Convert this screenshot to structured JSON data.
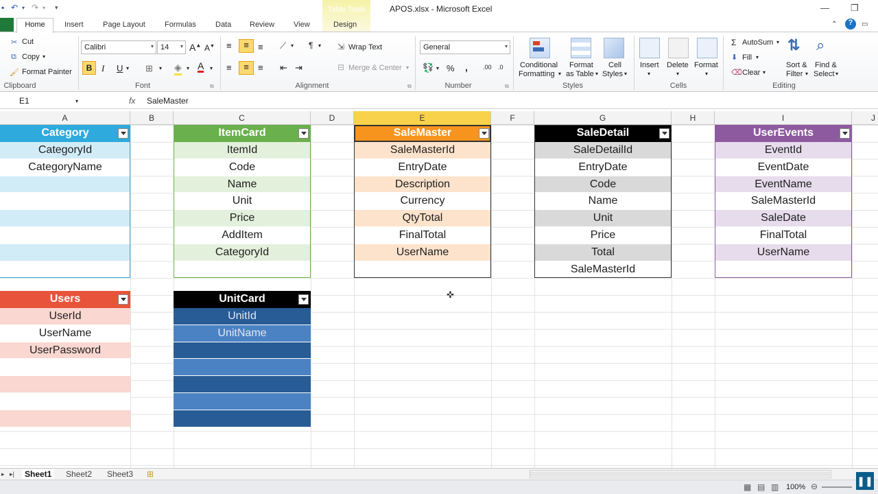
{
  "title": {
    "app_title": "APOS.xlsx  -  Microsoft Excel",
    "context_group": "Table Tools"
  },
  "tabs": [
    "Home",
    "Insert",
    "Page Layout",
    "Formulas",
    "Data",
    "Review",
    "View",
    "Design"
  ],
  "clipboard": {
    "cut": "Cut",
    "copy": "Copy",
    "format_painter": "Format Painter",
    "label": "Clipboard"
  },
  "font": {
    "name": "Calibri",
    "size": "14",
    "bold": "B",
    "italic": "I",
    "underline": "U",
    "label": "Font"
  },
  "alignment": {
    "wrap_text": "Wrap Text",
    "merge_center": "Merge & Center",
    "label": "Alignment"
  },
  "number": {
    "format": "General",
    "percent": "%",
    "comma": ",",
    "label": "Number"
  },
  "styles": {
    "conditional": "Conditional",
    "conditional2": "Formatting",
    "format_as": "Format",
    "format_as2": "as Table",
    "cell": "Cell",
    "cell2": "Styles",
    "label": "Styles"
  },
  "cells": {
    "insert": "Insert",
    "delete": "Delete",
    "format": "Format",
    "label": "Cells"
  },
  "editing": {
    "autosum": "AutoSum",
    "fill": "Fill",
    "clear": "Clear",
    "sort": "Sort &",
    "sort2": "Filter",
    "find": "Find &",
    "find2": "Select",
    "label": "Editing"
  },
  "formula_bar": {
    "name_box": "E1",
    "fx": "fx",
    "content": "SaleMaster"
  },
  "columns": [
    "A",
    "B",
    "C",
    "D",
    "E",
    "F",
    "G",
    "H",
    "I",
    "J"
  ],
  "tables": [
    {
      "name": "Category",
      "rows": [
        "CategoryId",
        "CategoryName",
        "",
        "",
        "",
        "",
        "",
        ""
      ]
    },
    {
      "name": "ItemCard",
      "rows": [
        "ItemId",
        "Code",
        "Name",
        "Unit",
        "Price",
        "AddItem",
        "CategoryId",
        ""
      ]
    },
    {
      "name": "SaleMaster",
      "rows": [
        "SaleMasterId",
        "EntryDate",
        "Description",
        "Currency",
        "QtyTotal",
        "FinalTotal",
        "UserName",
        ""
      ]
    },
    {
      "name": "SaleDetail",
      "rows": [
        "SaleDetailId",
        "EntryDate",
        "Code",
        "Name",
        "Unit",
        "Price",
        "Total",
        "SaleMasterId"
      ]
    },
    {
      "name": "UserEvents",
      "rows": [
        "EventId",
        "EventDate",
        "EventName",
        "SaleMasterId",
        "SaleDate",
        "FinalTotal",
        "UserName",
        ""
      ]
    },
    {
      "name": "Users",
      "rows": [
        "UserId",
        "UserName",
        "UserPassword",
        "",
        "",
        "",
        ""
      ]
    },
    {
      "name": "UnitCard",
      "rows": [
        "UnitId",
        "UnitName",
        "",
        "",
        "",
        "",
        ""
      ]
    }
  ],
  "sheets": [
    "Sheet1",
    "Sheet2",
    "Sheet3"
  ],
  "status": {
    "zoom": "100%"
  },
  "colors": {
    "category": "#2eaadc",
    "itemcard": "#6ab04c",
    "salemaster": "#f7941d",
    "saledetail": "#000000",
    "userevents": "#8e5a9f",
    "users": "#e8533b",
    "unitcard": "#000000"
  }
}
